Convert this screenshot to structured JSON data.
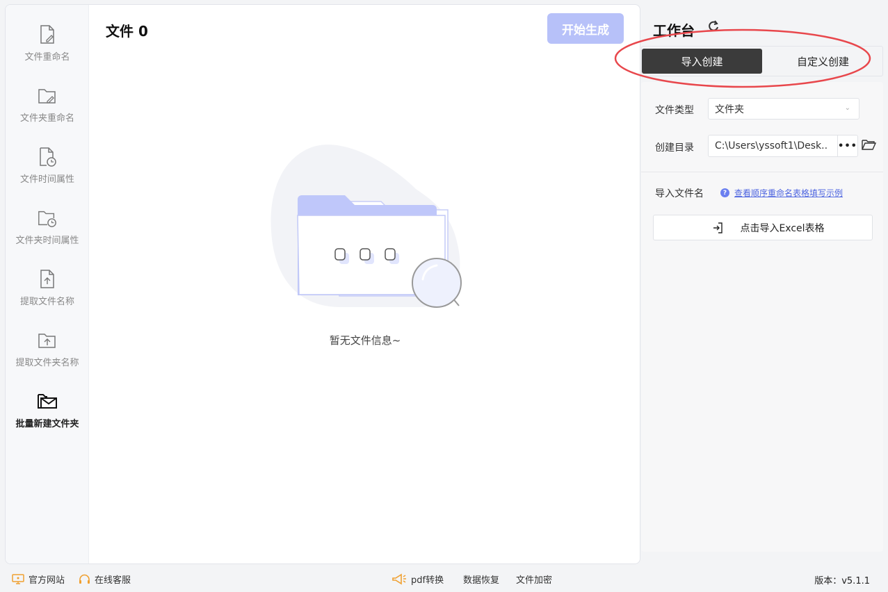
{
  "sidebar": {
    "items": [
      {
        "label": "文件重命名",
        "icon": "file-edit-icon"
      },
      {
        "label": "文件夹重命名",
        "icon": "folder-edit-icon"
      },
      {
        "label": "文件时间属性",
        "icon": "file-clock-icon"
      },
      {
        "label": "文件夹时间属性",
        "icon": "folder-clock-icon"
      },
      {
        "label": "提取文件名称",
        "icon": "file-upload-icon"
      },
      {
        "label": "提取文件夹名称",
        "icon": "folder-upload-icon"
      },
      {
        "label": "批量新建文件夹",
        "icon": "folder-mail-icon",
        "active": true
      }
    ]
  },
  "main": {
    "title": "文件 0",
    "start_button": "开始生成",
    "empty_text": "暂无文件信息~"
  },
  "right_panel": {
    "title": "工作台",
    "tabs": [
      {
        "label": "导入创建",
        "active": true
      },
      {
        "label": "自定义创建",
        "active": false
      }
    ],
    "file_type_label": "文件类型",
    "file_type_value": "文件夹",
    "dir_label": "创建目录",
    "dir_value": "C:\\Users\\yssoft1\\Desk..",
    "dir_more": "•••",
    "import_name_label": "导入文件名",
    "help_link": "查看顺序重命名表格填写示例",
    "import_excel_button": "点击导入Excel表格"
  },
  "footer": {
    "website": "官方网站",
    "support": "在线客服",
    "pdf": "pdf转换",
    "recovery": "数据恢复",
    "encrypt": "文件加密",
    "version": "版本：v5.1.1"
  },
  "colors": {
    "accent": "#b7c1f9",
    "active_tab": "#3b3b3b",
    "link": "#4f66e0",
    "annotation": "#e8474c",
    "footer_icon": "#f0a030"
  }
}
